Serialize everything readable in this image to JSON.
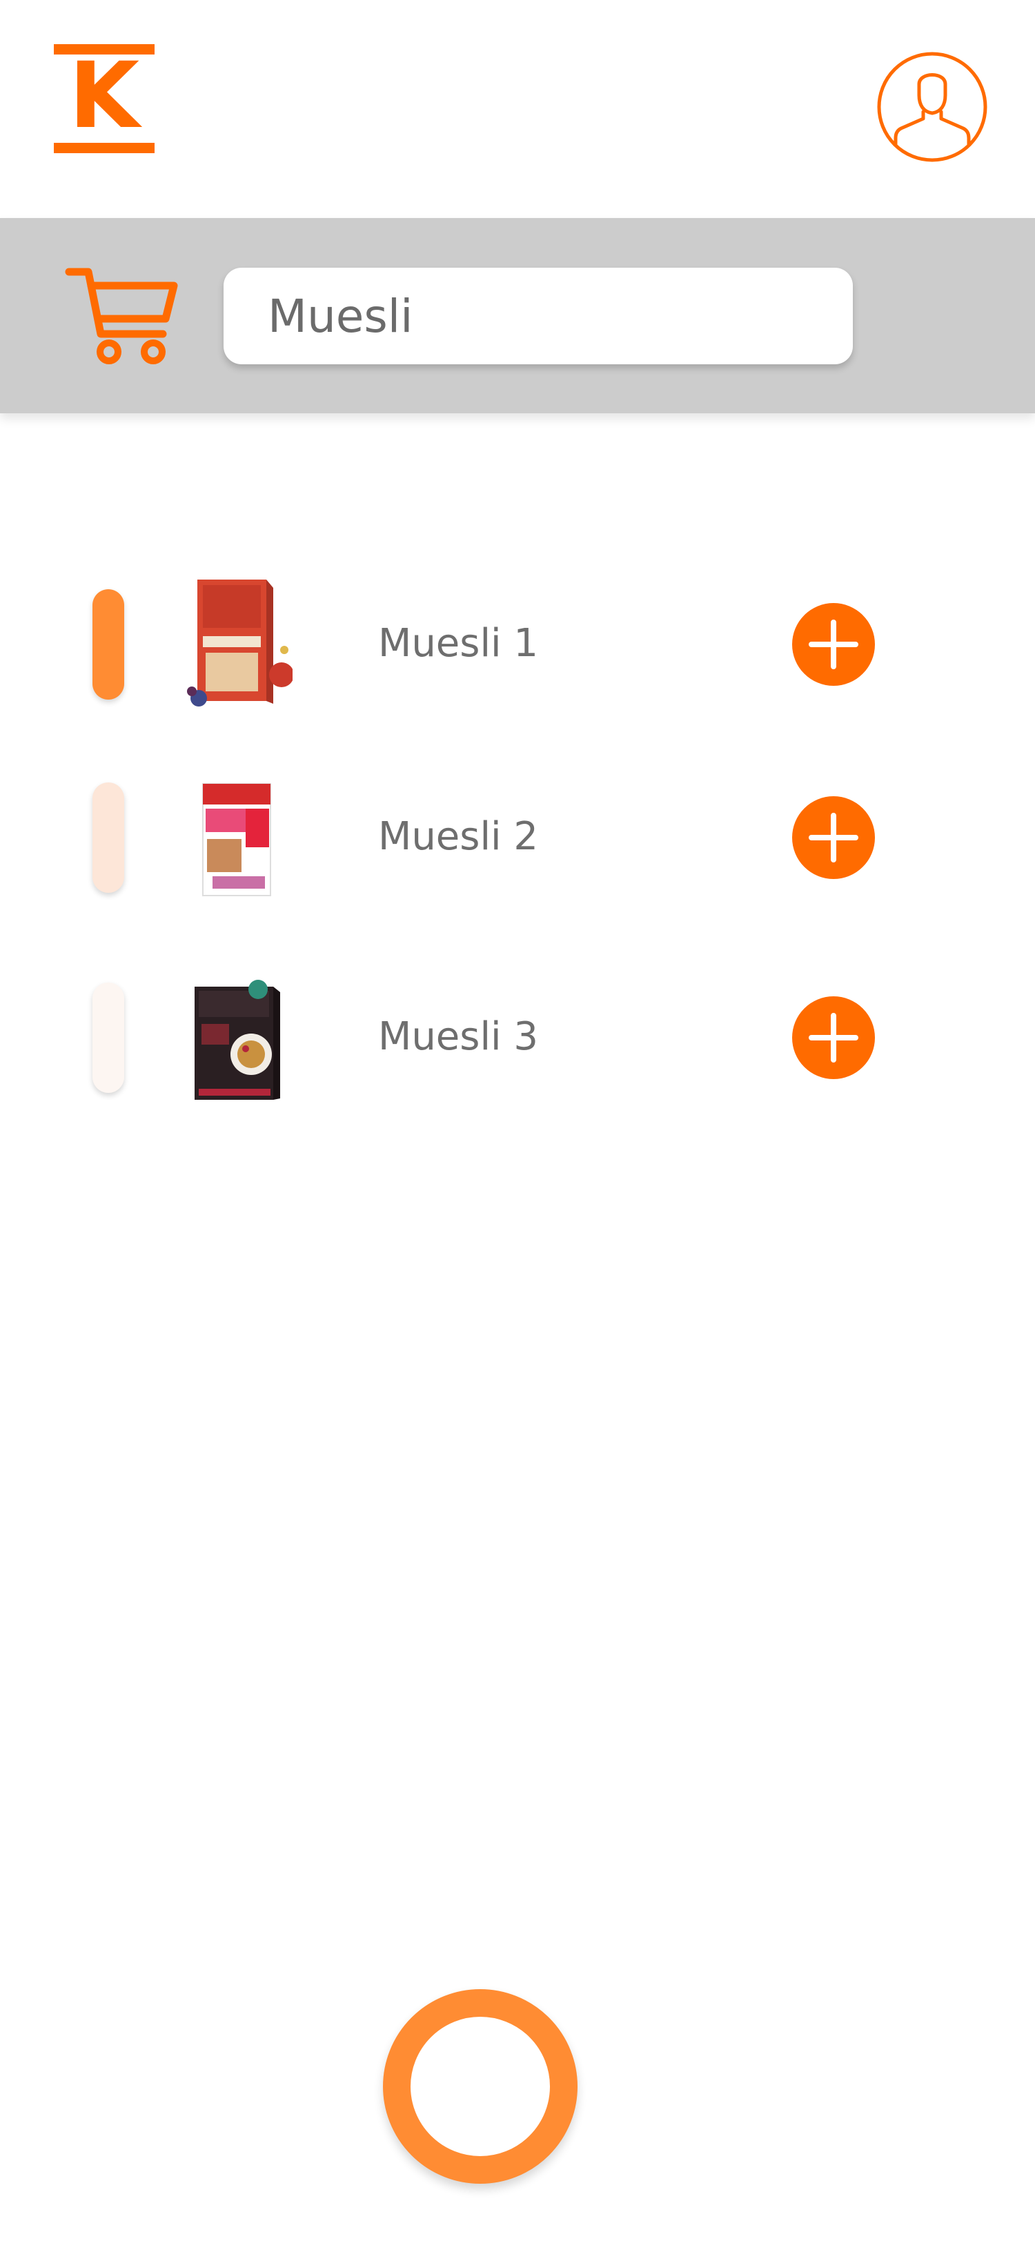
{
  "header": {
    "logo_letter": "K"
  },
  "search": {
    "value": "Muesli"
  },
  "results": [
    {
      "name": "Muesli 1",
      "product_image": "rude-health-muesli-box"
    },
    {
      "name": "Muesli 2",
      "product_image": "kelloggs-fruit-nut-muesli-box"
    },
    {
      "name": "Muesli 3",
      "product_image": "carmans-fruit-nut-muesli-box"
    }
  ],
  "colors": {
    "accent": "#ff6b00",
    "record_ring": "#ff8c33",
    "search_bar": "#cccccc",
    "indicator_1": "#ff8c33",
    "indicator_2": "#fde6d8",
    "indicator_3": "#fdf6f2"
  },
  "icons": {
    "profile": "user-profile-icon",
    "cart": "shopping-cart-icon",
    "add": "plus-icon",
    "record": "record-button-ring"
  }
}
